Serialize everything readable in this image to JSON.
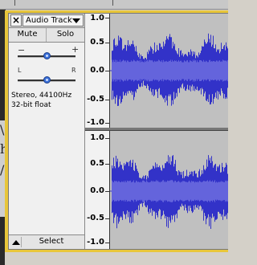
{
  "track": {
    "close_label": "×",
    "name": "Audio Track",
    "mute_label": "Mute",
    "solo_label": "Solo",
    "gain_minus": "−",
    "gain_plus": "+",
    "pan_left": "L",
    "pan_right": "R",
    "info_line1": "Stereo, 44100Hz",
    "info_line2": "32-bit float",
    "select_label": "Select",
    "gain_level": 0.5,
    "pan_level": 0.5
  },
  "vertical_ruler": {
    "channel_1_ticks": [
      "1.0",
      "0.5",
      "0.0",
      "-0.5",
      "-1.0"
    ],
    "channel_2_ticks": [
      "1.0",
      "0.5",
      "0.0",
      "-0.5",
      "-1.0"
    ]
  },
  "background_text": [
    "\\",
    "h",
    "/"
  ],
  "colors": {
    "selection_border": "#e8c63a",
    "waveform": "#3232c8",
    "waveform_rms": "#6464dc",
    "waveform_bg": "#c0c0c0",
    "slider_thumb": "#3a6fd8"
  },
  "icons": {
    "close": "close-icon",
    "menu": "dropdown-arrow-icon",
    "collapse": "collapse-arrow-icon"
  }
}
